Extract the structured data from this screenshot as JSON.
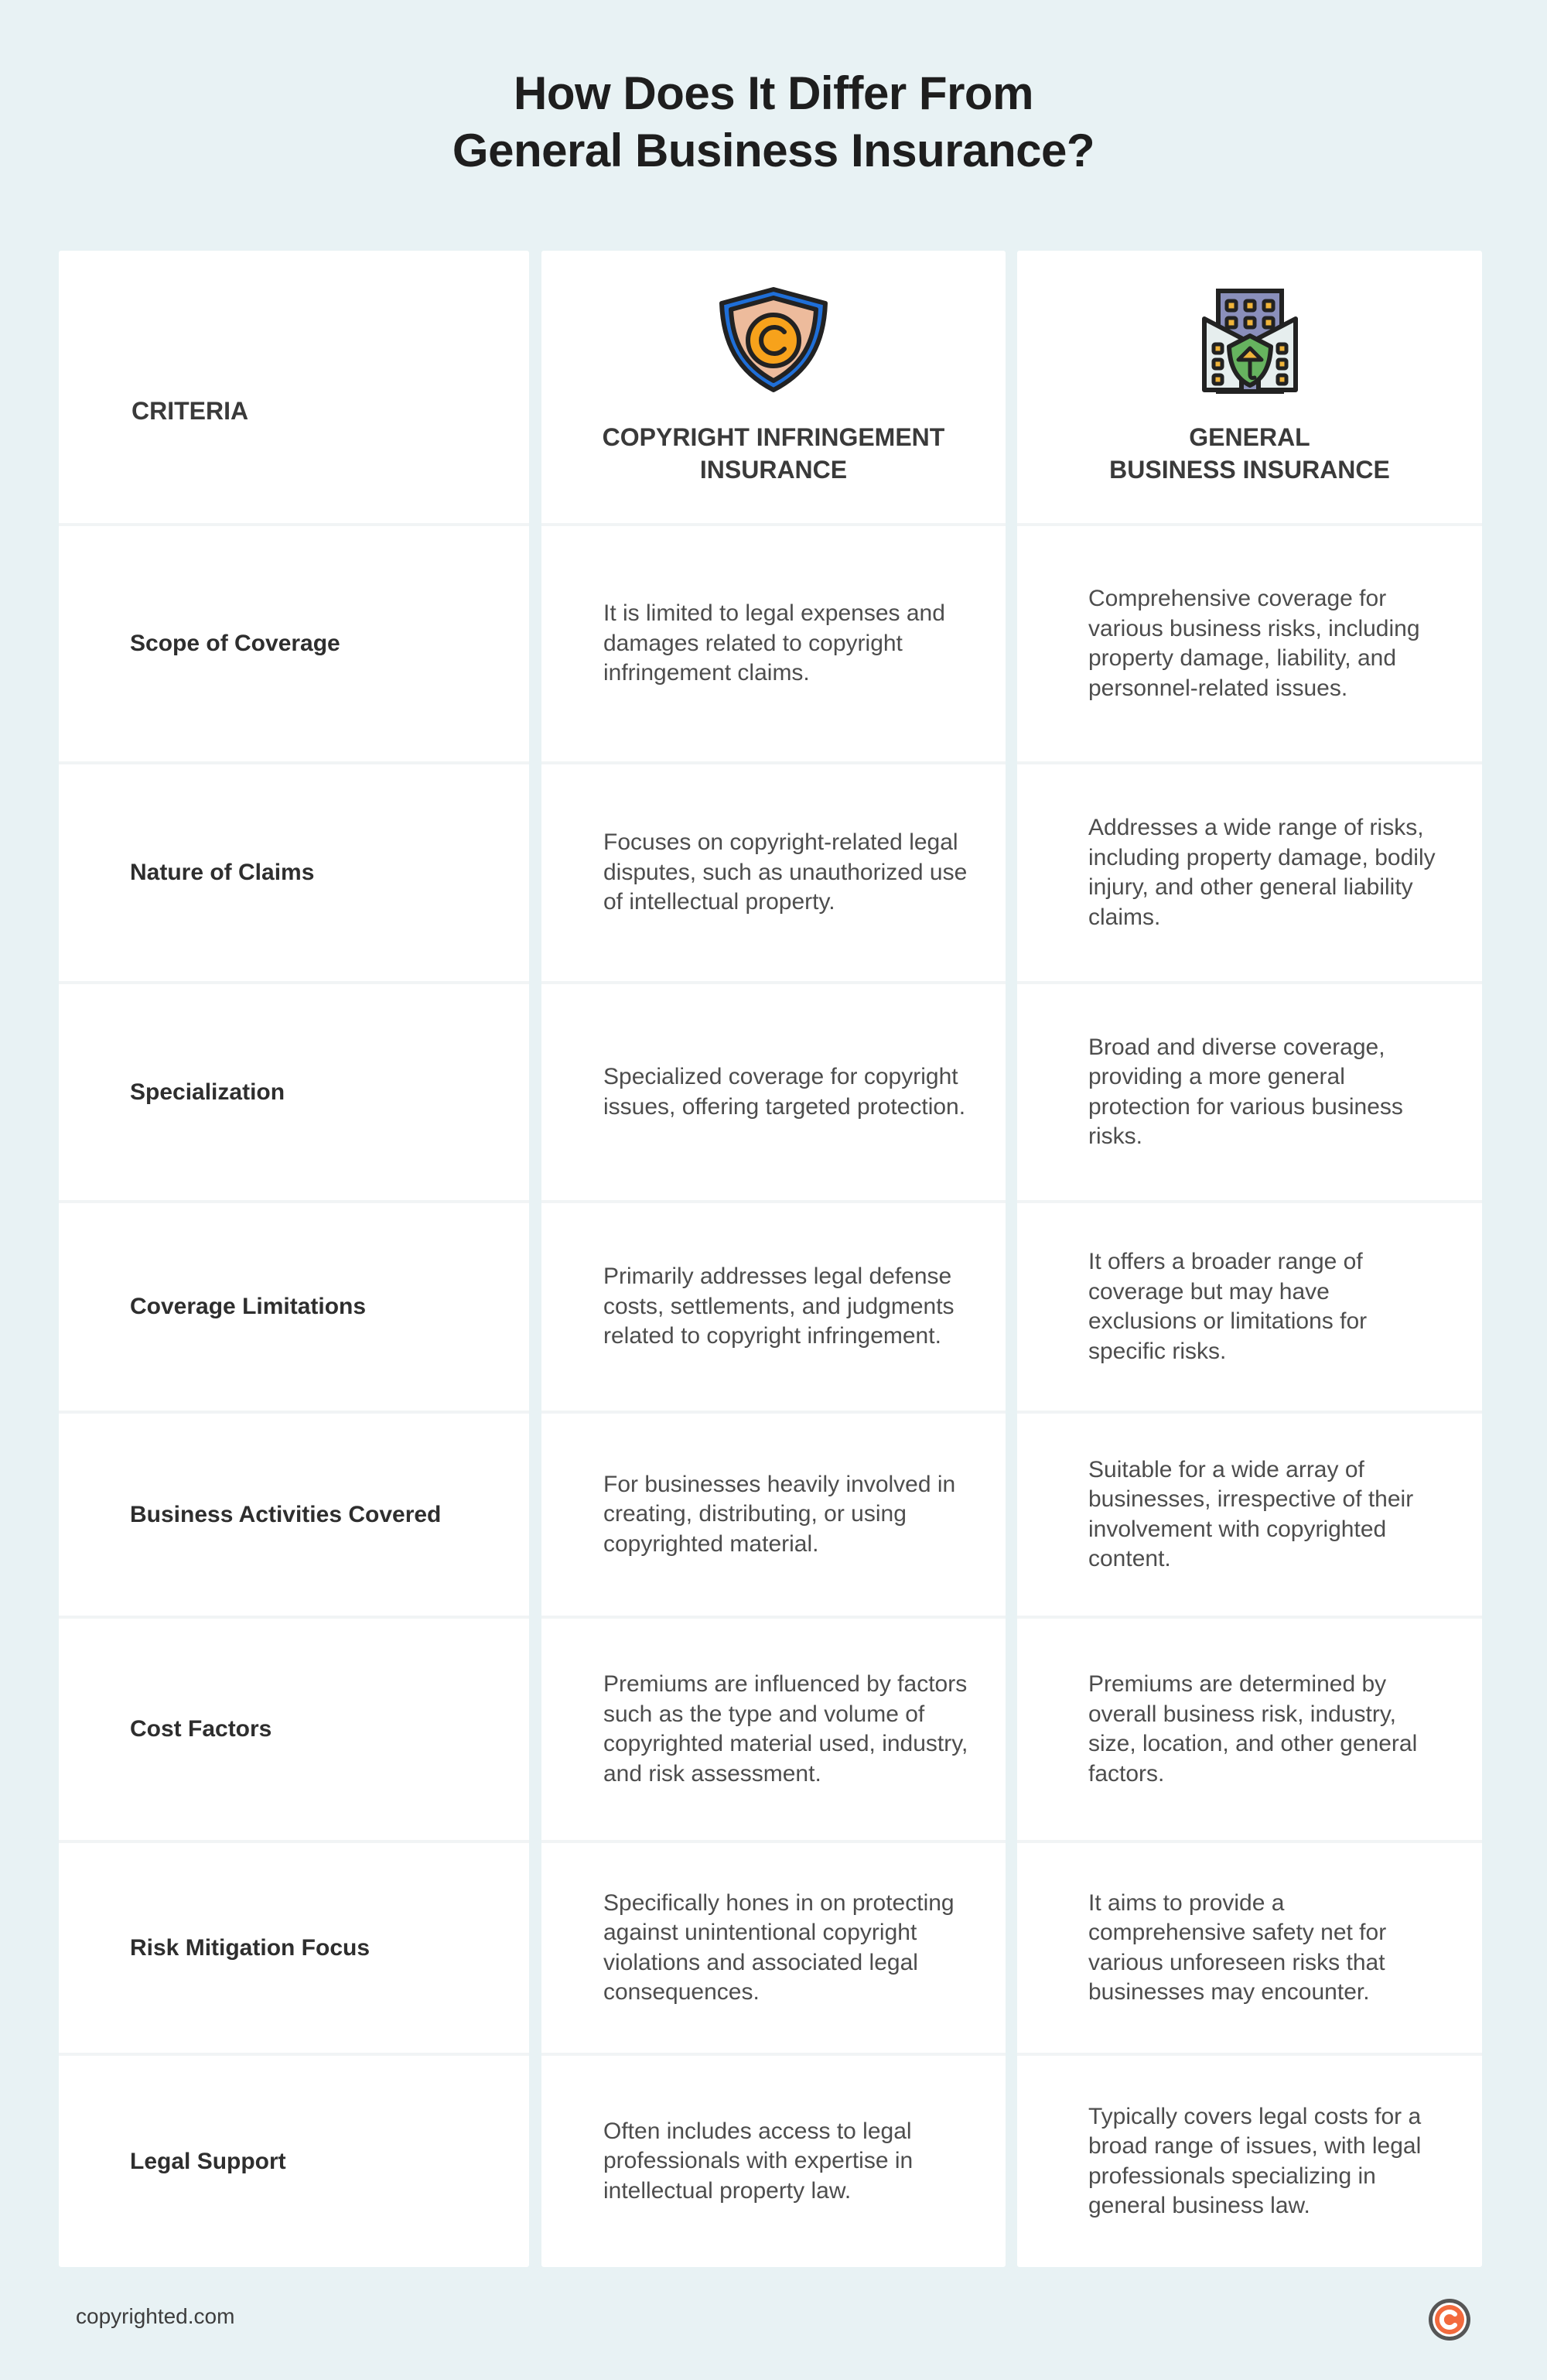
{
  "title": {
    "line1": "How Does It Differ From",
    "line2": "General Business Insurance?"
  },
  "header": {
    "criteria": "CRITERIA",
    "copyright_col": {
      "line1": "COPYRIGHT INFRINGEMENT",
      "line2": "INSURANCE",
      "icon": "shield-copyright-icon"
    },
    "general_col": {
      "line1": "GENERAL",
      "line2": "BUSINESS INSURANCE",
      "icon": "building-shield-umbrella-icon"
    }
  },
  "rows": [
    {
      "criteria": "Scope of Coverage",
      "copyright": "It is limited to legal expenses and damages related to copyright infringement claims.",
      "general": "Comprehensive coverage for various business risks, including property damage, liability, and personnel-related issues."
    },
    {
      "criteria": "Nature of Claims",
      "copyright": "Focuses on copyright-related legal disputes, such as unauthorized use of intellectual property.",
      "general": "Addresses a wide range of risks, including property damage, bodily injury, and other general liability claims."
    },
    {
      "criteria": "Specialization",
      "copyright": "Specialized coverage for copyright issues, offering targeted protection.",
      "general": "Broad and diverse coverage, providing a more general protection for various business risks."
    },
    {
      "criteria": "Coverage Limitations",
      "copyright": "Primarily addresses legal defense costs, settlements, and judgments related to copyright infringement.",
      "general": "It offers a broader range of coverage but may have exclusions or limitations for specific risks."
    },
    {
      "criteria": "Business Activities Covered",
      "copyright": "For businesses heavily involved in creating, distributing, or using copyrighted material.",
      "general": "Suitable for a wide array of businesses, irrespective of their involvement with copyrighted content."
    },
    {
      "criteria": "Cost Factors",
      "copyright": "Premiums are influenced by factors such as the type and volume of copyrighted material used, industry, and risk assessment.",
      "general": "Premiums are determined by overall business risk, industry, size, location, and other general factors."
    },
    {
      "criteria": "Risk Mitigation Focus",
      "copyright": "Specifically hones in on protecting against unintentional copyright violations and associated legal consequences.",
      "general": "It aims to provide a comprehensive safety net for various unforeseen risks that businesses may encounter."
    },
    {
      "criteria": "Legal Support",
      "copyright": "Often includes access to legal professionals with expertise in intellectual property law.",
      "general": "Typically covers legal costs for a broad range of issues, with legal professionals specializing in general business law."
    }
  ],
  "footer": {
    "site": "copyrighted.com",
    "logo_icon": "copyright-logo-icon"
  },
  "colors": {
    "background": "#e8f2f4",
    "card": "#ffffff",
    "shield_blue": "#1f6fd8",
    "shield_fill": "#edbb9c",
    "coin_orange": "#f7a21b",
    "building_purple": "#8a8fbb",
    "shield_green": "#66b35f",
    "logo_orange": "#f26a3d"
  }
}
